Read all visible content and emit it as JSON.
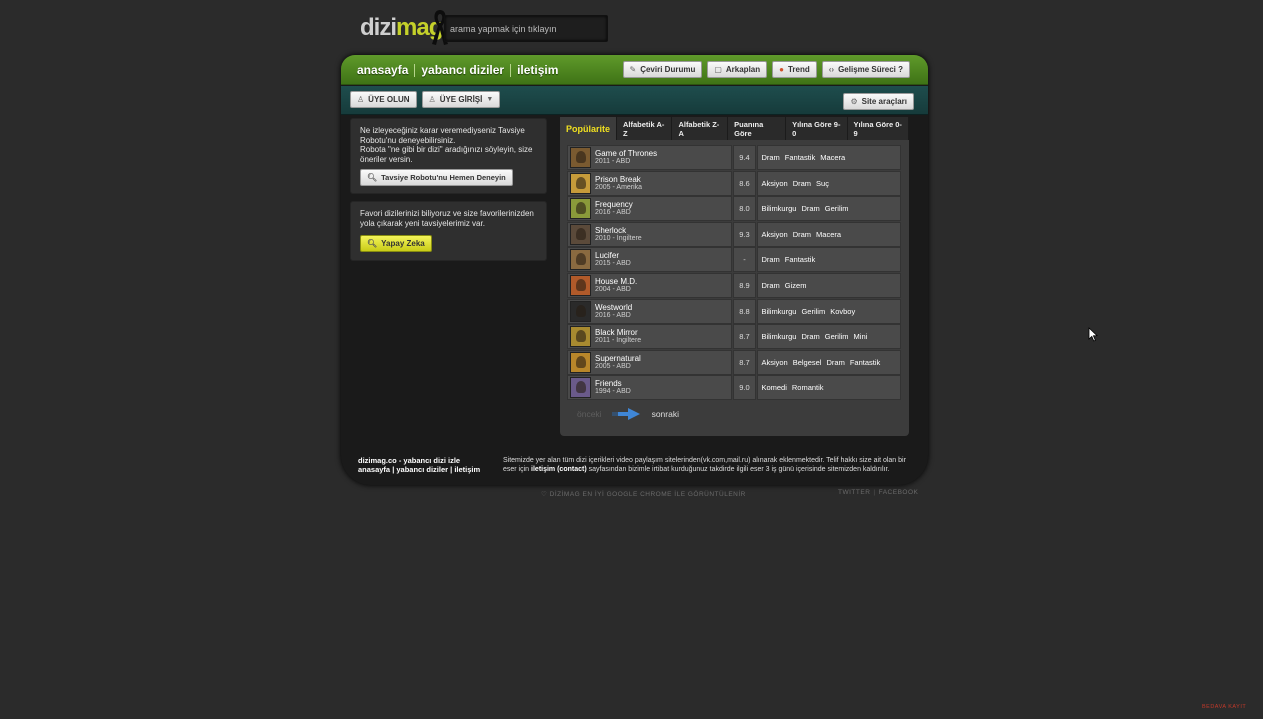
{
  "header": {
    "logo_part1": "dizi",
    "logo_part2": "mag",
    "search_placeholder": "arama yapmak için tıklayın"
  },
  "nav": {
    "items": [
      "anasayfa",
      "yabancı diziler",
      "iletişim"
    ]
  },
  "top_buttons": [
    {
      "label": "Çeviri Durumu",
      "icon": "pencil-icon"
    },
    {
      "label": "Arkaplan",
      "icon": "image-icon"
    },
    {
      "label": "Trend",
      "icon": "flame-icon"
    },
    {
      "label": "Gelişme Süreci ?",
      "icon": "code-icon"
    }
  ],
  "sub_buttons": {
    "signup": "ÜYE OLUN",
    "login": "ÜYE GİRİŞİ",
    "site_tools": "Site araçları"
  },
  "panels": {
    "robot_text_1": "Ne izleyeceğiniz karar veremediyseniz Tavsiye Robotu'nu deneyebilirsiniz.",
    "robot_text_2": "Robota \"ne gibi bir dizi\" aradığınızı söyleyin, size öneriler versin.",
    "robot_button": "Tavsiye Robotu'nu Hemen Deneyin",
    "ai_text": "Favori dizilerinizi biliyoruz ve size favorilerinizden yola çıkarak yeni tavsiyelerimiz var.",
    "ai_button": "Yapay Zeka"
  },
  "tabs": [
    "Popülarite",
    "Alfabetik A-Z",
    "Alfabetik Z-A",
    "Puanına Göre",
    "Yılına Göre 9-0",
    "Yılına Göre 0-9"
  ],
  "shows": [
    {
      "title": "Game of Thrones",
      "sub": "2011 - ABD",
      "score": "9.4",
      "genres": [
        "Dram",
        "Fantastik",
        "Macera"
      ],
      "thumb": "#7a5a30"
    },
    {
      "title": "Prison Break",
      "sub": "2005 - Amerika",
      "score": "8.6",
      "genres": [
        "Aksiyon",
        "Dram",
        "Suç"
      ],
      "thumb": "#c69b3a"
    },
    {
      "title": "Frequency",
      "sub": "2016 - ABD",
      "score": "8.0",
      "genres": [
        "Bilimkurgu",
        "Dram",
        "Gerilim"
      ],
      "thumb": "#8a9a3a"
    },
    {
      "title": "Sherlock",
      "sub": "2010 - İngiltere",
      "score": "9.3",
      "genres": [
        "Aksiyon",
        "Dram",
        "Macera"
      ],
      "thumb": "#5b4a3a"
    },
    {
      "title": "Lucifer",
      "sub": "2015 - ABD",
      "score": "-",
      "genres": [
        "Dram",
        "Fantastik"
      ],
      "thumb": "#8a6a40"
    },
    {
      "title": "House M.D.",
      "sub": "2004 - ABD",
      "score": "8.9",
      "genres": [
        "Dram",
        "Gizem"
      ],
      "thumb": "#b05a2a"
    },
    {
      "title": "Westworld",
      "sub": "2016 - ABD",
      "score": "8.8",
      "genres": [
        "Bilimkurgu",
        "Gerilim",
        "Kovboy"
      ],
      "thumb": "#2a2a2a"
    },
    {
      "title": "Black Mirror",
      "sub": "2011 - İngiltere",
      "score": "8.7",
      "genres": [
        "Bilimkurgu",
        "Dram",
        "Gerilim",
        "Mini"
      ],
      "thumb": "#a88a30"
    },
    {
      "title": "Supernatural",
      "sub": "2005 - ABD",
      "score": "8.7",
      "genres": [
        "Aksiyon",
        "Belgesel",
        "Dram",
        "Fantastik"
      ],
      "thumb": "#b8862a"
    },
    {
      "title": "Friends",
      "sub": "1994 - ABD",
      "score": "9.0",
      "genres": [
        "Komedi",
        "Romantik"
      ],
      "thumb": "#6a5a8a"
    }
  ],
  "pager": {
    "prev": "önceki",
    "next": "sonraki"
  },
  "footer": {
    "left_line1": "dizimag.co - yabancı dizi izle",
    "left_line2": "anasayfa | yabancı diziler | iletişim",
    "right_a": "Sitemizde yer alan tüm dizi içerikleri video paylaşım sitelerinden(vk.com,mail.ru) alınarak eklenmektedir. Telif hakkı size ait olan bir eser için",
    "right_link": "iletişim (contact)",
    "right_b": "sayfasından bizimle irtibat kurduğunuz takdirde ilgili eser 3 iş günü içerisinde sitemizden kaldırılır."
  },
  "below": {
    "chrome_note": "DİZİMAG EN İYİ GOOGLE CHROME İLE GÖRÜNTÜLENİR",
    "twitter": "TWITTER",
    "facebook": "FACEBOOK"
  },
  "watermark": "BEDAVA KAYIT",
  "colors": {
    "accent_green": "#4f8a20",
    "accent_yellow": "#f0e020",
    "teal": "#1c4646"
  }
}
